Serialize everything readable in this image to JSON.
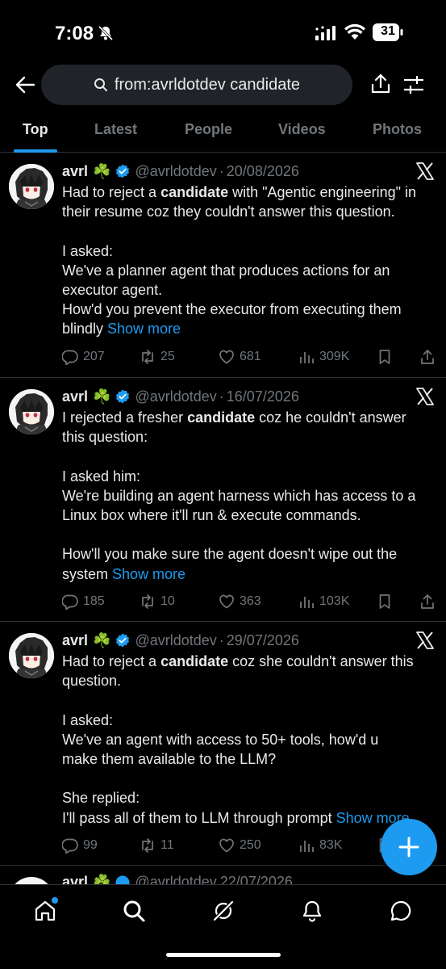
{
  "status_bar": {
    "time": "7:08",
    "battery": "31"
  },
  "search": {
    "query": "from:avrldotdev candidate"
  },
  "tabs": [
    {
      "label": "Top",
      "active": true
    },
    {
      "label": "Latest",
      "active": false
    },
    {
      "label": "People",
      "active": false
    },
    {
      "label": "Videos",
      "active": false
    },
    {
      "label": "Photos",
      "active": false
    }
  ],
  "posts": [
    {
      "name": "avrl",
      "emoji": "☘️",
      "handle": "@avrldotdev",
      "date": "20/08/2026",
      "lines": [
        [
          "Had to reject a ",
          "candidate",
          " with \"Agentic engineering\" in"
        ],
        "their resume coz they couldn't answer this question.",
        "",
        "I asked:",
        "We've a planner agent that produces actions for an",
        "executor agent.",
        "How'd you prevent the executor from executing them",
        "blindly"
      ],
      "show_more": "Show more",
      "replies": "207",
      "reposts": "25",
      "likes": "681",
      "views": "309K"
    },
    {
      "name": "avrl",
      "emoji": "☘️",
      "handle": "@avrldotdev",
      "date": "16/07/2026",
      "lines": [
        [
          "I rejected a fresher ",
          "candidate",
          " coz he couldn't answer"
        ],
        "this question:",
        "",
        "I asked him:",
        "We're building an agent harness which has access to a",
        "Linux box where it'll run & execute commands.",
        "",
        "How'll you make sure the agent doesn't wipe out the",
        "system"
      ],
      "show_more": "Show more",
      "replies": "185",
      "reposts": "10",
      "likes": "363",
      "views": "103K"
    },
    {
      "name": "avrl",
      "emoji": "☘️",
      "handle": "@avrldotdev",
      "date": "29/07/2026",
      "lines": [
        [
          "Had to reject a ",
          "candidate",
          " coz she couldn't answer this"
        ],
        "question.",
        "",
        "I asked:",
        "We've an agent with access to 50+ tools, how'd u",
        "make them available to the LLM?",
        "",
        "She replied:",
        "I'll pass all of them to LLM through prompt"
      ],
      "show_more": "Show more",
      "replies": "99",
      "reposts": "11",
      "likes": "250",
      "views": "83K"
    }
  ],
  "peek_post": {
    "name": "avrl",
    "emoji": "☘️",
    "handle": "@avrldotdev",
    "date": "22/07/2026"
  },
  "colors": {
    "accent": "#1d9bf0",
    "muted": "#71767b",
    "divider": "#2f3336"
  }
}
